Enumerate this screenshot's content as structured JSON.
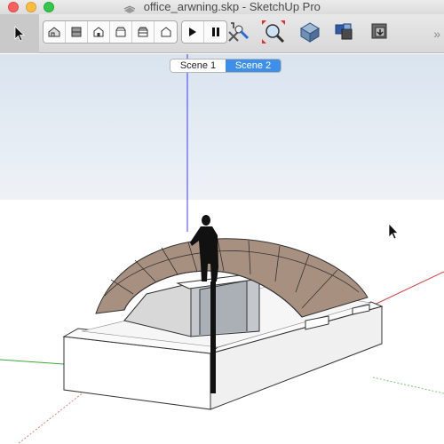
{
  "window": {
    "title": "office_arwning.skp - SketchUp Pro",
    "controls": [
      "close",
      "minimize",
      "maximize"
    ]
  },
  "toolbar": {
    "tools": [
      {
        "name": "select-tool",
        "icon": "arrow-pointer-icon"
      },
      {
        "name": "iso-view",
        "icon": "iso-house-icon"
      },
      {
        "name": "top-view",
        "icon": "top-view-icon"
      },
      {
        "name": "front-view",
        "icon": "front-house-icon"
      },
      {
        "name": "right-view",
        "icon": "right-view-icon"
      },
      {
        "name": "back-view",
        "icon": "back-view-icon"
      },
      {
        "name": "left-view",
        "icon": "left-view-icon"
      },
      {
        "name": "play-animation",
        "icon": "play-icon"
      },
      {
        "name": "pause-animation",
        "icon": "pause-icon"
      },
      {
        "name": "position-camera",
        "icon": "position-camera-icon"
      },
      {
        "name": "zoom-extents",
        "icon": "zoom-extents-icon"
      },
      {
        "name": "3d-warehouse",
        "icon": "warehouse-icon"
      },
      {
        "name": "extension-warehouse",
        "icon": "extension-icon"
      },
      {
        "name": "share-model",
        "icon": "share-icon"
      }
    ],
    "overflow": "»"
  },
  "scenes": {
    "tabs": [
      {
        "label": "Scene 1",
        "active": false
      },
      {
        "label": "Scene 2",
        "active": true
      }
    ]
  },
  "colors": {
    "sky": "#e3ebf3",
    "ground": "#ffffff",
    "awning": "#a89080",
    "accent": "#3d8fe9",
    "blue_axis": "#3c3cff",
    "red_axis": "#d94040",
    "green_axis": "#3aa83a"
  }
}
